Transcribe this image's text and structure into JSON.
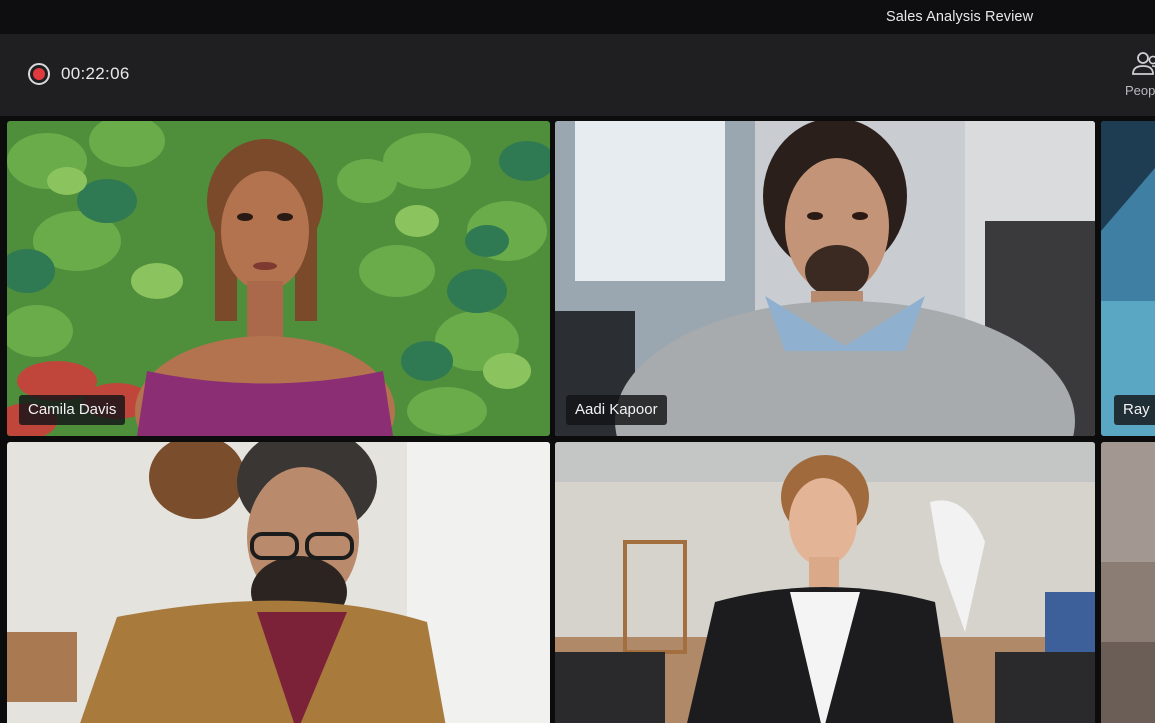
{
  "window": {
    "title": "Sales Analysis Review"
  },
  "toolbar": {
    "recording_timer": "00:22:06",
    "people_label": "People",
    "recording_color": "#e03a3e"
  },
  "participants": [
    {
      "name": "Camila Davis"
    },
    {
      "name": "Aadi Kapoor"
    },
    {
      "name": "Ray"
    },
    {
      "name": ""
    },
    {
      "name": ""
    },
    {
      "name": ""
    }
  ],
  "icons": {
    "recording": "record-circle-icon",
    "people": "people-icon"
  }
}
